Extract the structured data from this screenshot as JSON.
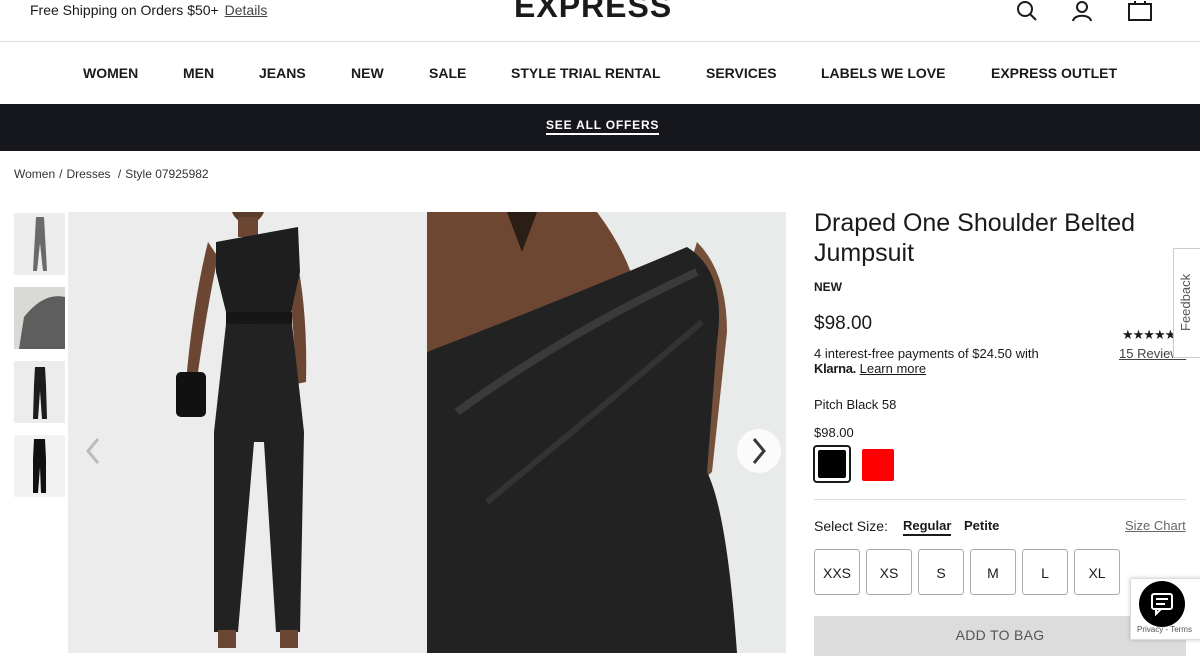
{
  "header": {
    "shipping_text": "Free Shipping on Orders $50+",
    "details_link": "Details",
    "logo": "EXPRESS",
    "icons": [
      "search-icon",
      "account-icon",
      "bag-icon"
    ]
  },
  "nav": {
    "items": [
      "WOMEN",
      "MEN",
      "JEANS",
      "NEW",
      "SALE",
      "STYLE TRIAL RENTAL",
      "SERVICES",
      "LABELS WE LOVE",
      "EXPRESS OUTLET"
    ]
  },
  "promo": {
    "label": "SEE ALL OFFERS"
  },
  "breadcrumb": {
    "items": [
      "Women",
      "Dresses"
    ],
    "sep": "/",
    "current": "Style 07925982"
  },
  "product": {
    "title": "Draped One Shoulder Belted Jumpsuit",
    "badge": "NEW",
    "price": "$98.00",
    "stars_text": "★★★★★",
    "reviews": "15 Reviews",
    "klarna_line1": "4 interest-free payments of $24.50 with",
    "klarna_brand": "Klarna.",
    "klarna_learn": "Learn more",
    "color_name": "Pitch Black 58",
    "color_price": "$98.00",
    "swatch_colors": [
      "#000000",
      "#ff0000"
    ],
    "select_size_label": "Select Size:",
    "size_tabs": [
      "Regular",
      "Petite"
    ],
    "size_chart": "Size Chart",
    "sizes": [
      "XXS",
      "XS",
      "S",
      "M",
      "L",
      "XL"
    ],
    "add_to_bag": "ADD TO BAG"
  },
  "widgets": {
    "feedback": "Feedback",
    "recaptcha": "Privacy - Terms"
  }
}
